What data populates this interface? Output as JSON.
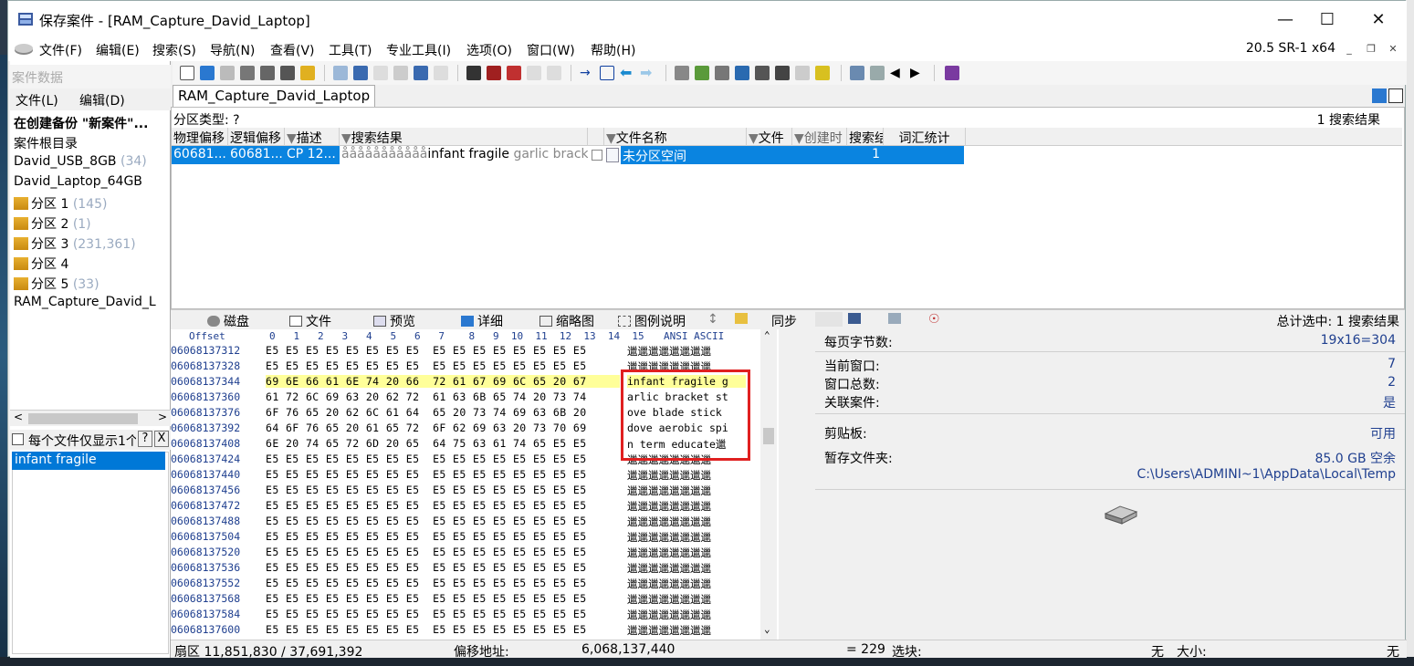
{
  "window": {
    "title": "保存案件 - [RAM_Capture_David_Laptop]",
    "version": "20.5 SR-1 x64"
  },
  "menubar": [
    "文件(F)",
    "编辑(E)",
    "搜索(S)",
    "导航(N)",
    "查看(V)",
    "工具(T)",
    "专业工具(I)",
    "选项(O)",
    "窗口(W)",
    "帮助(H)"
  ],
  "left_panel": {
    "header": "案件数据",
    "menu": [
      "文件(L)",
      "编辑(D)"
    ],
    "tree": [
      {
        "label": "在创建备份 \"新案件\"...",
        "count": ""
      },
      {
        "label": "案件根目录",
        "count": ""
      },
      {
        "label": "David_USB_8GB",
        "count": "(34)"
      },
      {
        "label": "David_Laptop_64GB",
        "count": ""
      },
      {
        "label": "分区 1",
        "count": "(145)"
      },
      {
        "label": "分区 2",
        "count": "(1)"
      },
      {
        "label": "分区 3",
        "count": "(231,361)"
      },
      {
        "label": "分区 4",
        "count": ""
      },
      {
        "label": "分区 5",
        "count": "(33)"
      },
      {
        "label": "RAM_Capture_David_L",
        "count": ""
      }
    ],
    "filter_label": "每个文件仅显示1个",
    "filter_q": "?",
    "filter_x": "X",
    "filter_item": "infant fragile"
  },
  "tab": {
    "label": "RAM_Capture_David_Laptop"
  },
  "results": {
    "partition_type": "分区类型: ?",
    "count": "1 搜索结果",
    "columns": [
      "物理偏移",
      "逻辑偏移",
      "描述",
      "搜索结果",
      "文件名称",
      "文件",
      "创建时",
      "搜索结",
      "词汇统计"
    ],
    "row": {
      "phys": "60681...",
      "log": "60681...",
      "desc": "CP 12...",
      "hit_prefix": "ååååååååååå",
      "hit_term": "infant fragile",
      "hit_suffix": " garlic bracke",
      "filename": "未分区空间",
      "hits": "1"
    }
  },
  "lower_tabs": {
    "disk": "磁盘",
    "file": "文件",
    "preview": "预览",
    "details": "详细",
    "thumbs": "缩略图",
    "legend": "图例说明",
    "sync": "同步",
    "total": "总计选中: 1 搜索结果"
  },
  "hex": {
    "offset_label": "Offset",
    "cols": "0   1   2   3   4   5   6   7    8   9  10  11  12  13  14  15",
    "ascii_label": "ANSI ASCII",
    "rows": [
      {
        "off": "06068137312",
        "bytes": "E5 E5 E5 E5 E5 E5 E5 E5  E5 E5 E5 E5 E5 E5 E5 E5",
        "ascii": "邋邋邋邋邋邋邋邋"
      },
      {
        "off": "06068137328",
        "bytes": "E5 E5 E5 E5 E5 E5 E5 E5  E5 E5 E5 E5 E5 E5 E5 E5",
        "ascii": "邋邋邋邋邋邋邋邋"
      },
      {
        "off": "06068137344",
        "bytes": "69 6E 66 61 6E 74 20 66  72 61 67 69 6C 65 20 67",
        "ascii": "infant fragile g"
      },
      {
        "off": "06068137360",
        "bytes": "61 72 6C 69 63 20 62 72  61 63 6B 65 74 20 73 74",
        "ascii": "arlic bracket st"
      },
      {
        "off": "06068137376",
        "bytes": "6F 76 65 20 62 6C 61 64  65 20 73 74 69 63 6B 20",
        "ascii": "ove blade stick "
      },
      {
        "off": "06068137392",
        "bytes": "64 6F 76 65 20 61 65 72  6F 62 69 63 20 73 70 69",
        "ascii": "dove aerobic spi"
      },
      {
        "off": "06068137408",
        "bytes": "6E 20 74 65 72 6D 20 65  64 75 63 61 74 65 E5 E5",
        "ascii": "n term educate邋"
      },
      {
        "off": "06068137424",
        "bytes": "E5 E5 E5 E5 E5 E5 E5 E5  E5 E5 E5 E5 E5 E5 E5 E5",
        "ascii": "邋邋邋邋邋邋邋邋"
      },
      {
        "off": "06068137440",
        "bytes": "E5 E5 E5 E5 E5 E5 E5 E5  E5 E5 E5 E5 E5 E5 E5 E5",
        "ascii": "邋邋邋邋邋邋邋邋"
      },
      {
        "off": "06068137456",
        "bytes": "E5 E5 E5 E5 E5 E5 E5 E5  E5 E5 E5 E5 E5 E5 E5 E5",
        "ascii": "邋邋邋邋邋邋邋邋"
      },
      {
        "off": "06068137472",
        "bytes": "E5 E5 E5 E5 E5 E5 E5 E5  E5 E5 E5 E5 E5 E5 E5 E5",
        "ascii": "邋邋邋邋邋邋邋邋"
      },
      {
        "off": "06068137488",
        "bytes": "E5 E5 E5 E5 E5 E5 E5 E5  E5 E5 E5 E5 E5 E5 E5 E5",
        "ascii": "邋邋邋邋邋邋邋邋"
      },
      {
        "off": "06068137504",
        "bytes": "E5 E5 E5 E5 E5 E5 E5 E5  E5 E5 E5 E5 E5 E5 E5 E5",
        "ascii": "邋邋邋邋邋邋邋邋"
      },
      {
        "off": "06068137520",
        "bytes": "E5 E5 E5 E5 E5 E5 E5 E5  E5 E5 E5 E5 E5 E5 E5 E5",
        "ascii": "邋邋邋邋邋邋邋邋"
      },
      {
        "off": "06068137536",
        "bytes": "E5 E5 E5 E5 E5 E5 E5 E5  E5 E5 E5 E5 E5 E5 E5 E5",
        "ascii": "邋邋邋邋邋邋邋邋"
      },
      {
        "off": "06068137552",
        "bytes": "E5 E5 E5 E5 E5 E5 E5 E5  E5 E5 E5 E5 E5 E5 E5 E5",
        "ascii": "邋邋邋邋邋邋邋邋"
      },
      {
        "off": "06068137568",
        "bytes": "E5 E5 E5 E5 E5 E5 E5 E5  E5 E5 E5 E5 E5 E5 E5 E5",
        "ascii": "邋邋邋邋邋邋邋邋"
      },
      {
        "off": "06068137584",
        "bytes": "E5 E5 E5 E5 E5 E5 E5 E5  E5 E5 E5 E5 E5 E5 E5 E5",
        "ascii": "邋邋邋邋邋邋邋邋"
      },
      {
        "off": "06068137600",
        "bytes": "E5 E5 E5 E5 E5 E5 E5 E5  E5 E5 E5 E5 E5 E5 E5 E5",
        "ascii": "邋邋邋邋邋邋邋邋"
      }
    ]
  },
  "info": {
    "bytes_per_page_k": "每页字节数:",
    "bytes_per_page_v": "19x16=304",
    "current_window_k": "当前窗口:",
    "current_window_v": "7",
    "window_total_k": "窗口总数:",
    "window_total_v": "2",
    "linked_case_k": "关联案件:",
    "linked_case_v": "是",
    "clipboard_k": "剪贴板:",
    "clipboard_v": "可用",
    "temp_k": "暂存文件夹:",
    "temp_v": "85.0 GB 空余",
    "temp_path": "C:\\Users\\ADMINI~1\\AppData\\Local\\Temp"
  },
  "status": {
    "sector": "扇区 11,851,830 / 37,691,392",
    "offset_label": "偏移地址:",
    "offset_value": "6,068,137,440",
    "value": "= 229",
    "block_label": "选块:",
    "block_value": "无",
    "size_label": "大小:",
    "size_value": "无"
  },
  "colors": {
    "selection": "#0a84e0",
    "highlight": "#ffff99",
    "annotation_box": "#e02020",
    "offset_text": "#1f3f8f"
  }
}
